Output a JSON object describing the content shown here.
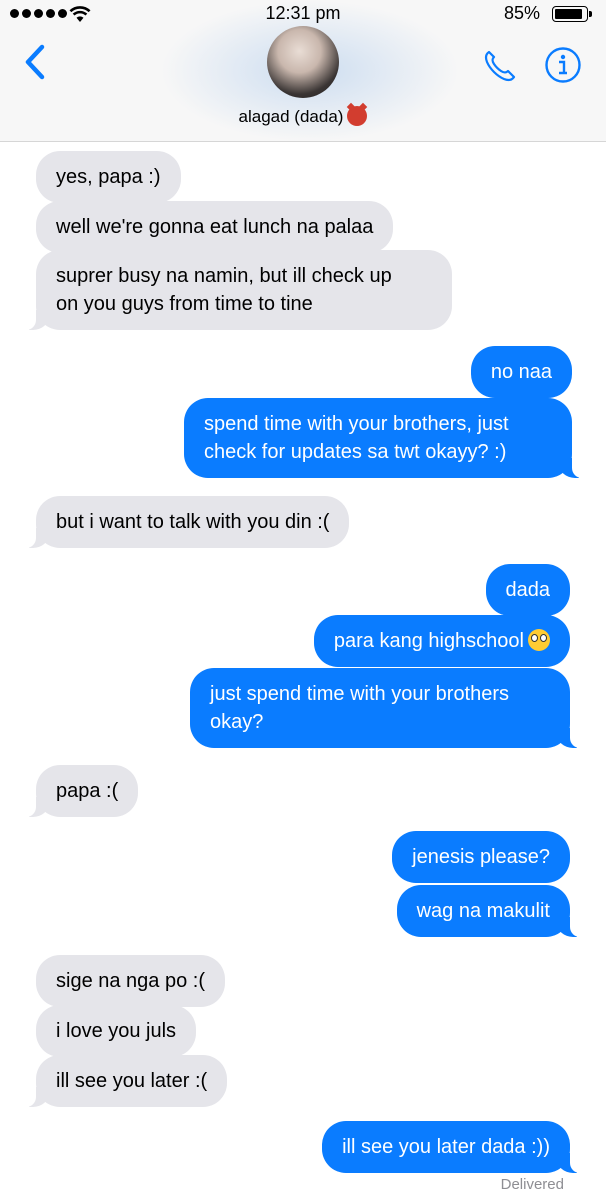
{
  "status_bar": {
    "time": "12:31 pm",
    "battery": "85%"
  },
  "contact": {
    "name": "alagad (dada)",
    "name_emoji": "ogre-emoji"
  },
  "colors": {
    "outgoing": "#0a7cff",
    "incoming": "#e5e5ea",
    "accent": "#0a7cff"
  },
  "messages": [
    {
      "dir": "in",
      "text": "yes, papa :)"
    },
    {
      "dir": "in",
      "text": "well we're gonna eat lunch na palaa"
    },
    {
      "dir": "in",
      "text": "suprer busy na namin, but ill check up\non you guys from time to tine"
    },
    {
      "dir": "out",
      "text": "no naa"
    },
    {
      "dir": "out",
      "text": "spend time with your brothers, just\ncheck for updates sa twt okayy? :)"
    },
    {
      "dir": "in",
      "text": "but i want to talk with you din :("
    },
    {
      "dir": "out",
      "text": "dada"
    },
    {
      "dir": "out",
      "text": "para kang highschool",
      "emoji": "rolling-eyes-emoji"
    },
    {
      "dir": "out",
      "text": "just spend time with your brothers\nokay?"
    },
    {
      "dir": "in",
      "text": "papa :("
    },
    {
      "dir": "out",
      "text": "jenesis please?"
    },
    {
      "dir": "out",
      "text": "wag na makulit"
    },
    {
      "dir": "in",
      "text": "sige na nga po :("
    },
    {
      "dir": "in",
      "text": "i love you juls"
    },
    {
      "dir": "in",
      "text": "ill see you later :("
    },
    {
      "dir": "out",
      "text": "ill see you later dada :))"
    }
  ],
  "delivered_label": "Delivered"
}
